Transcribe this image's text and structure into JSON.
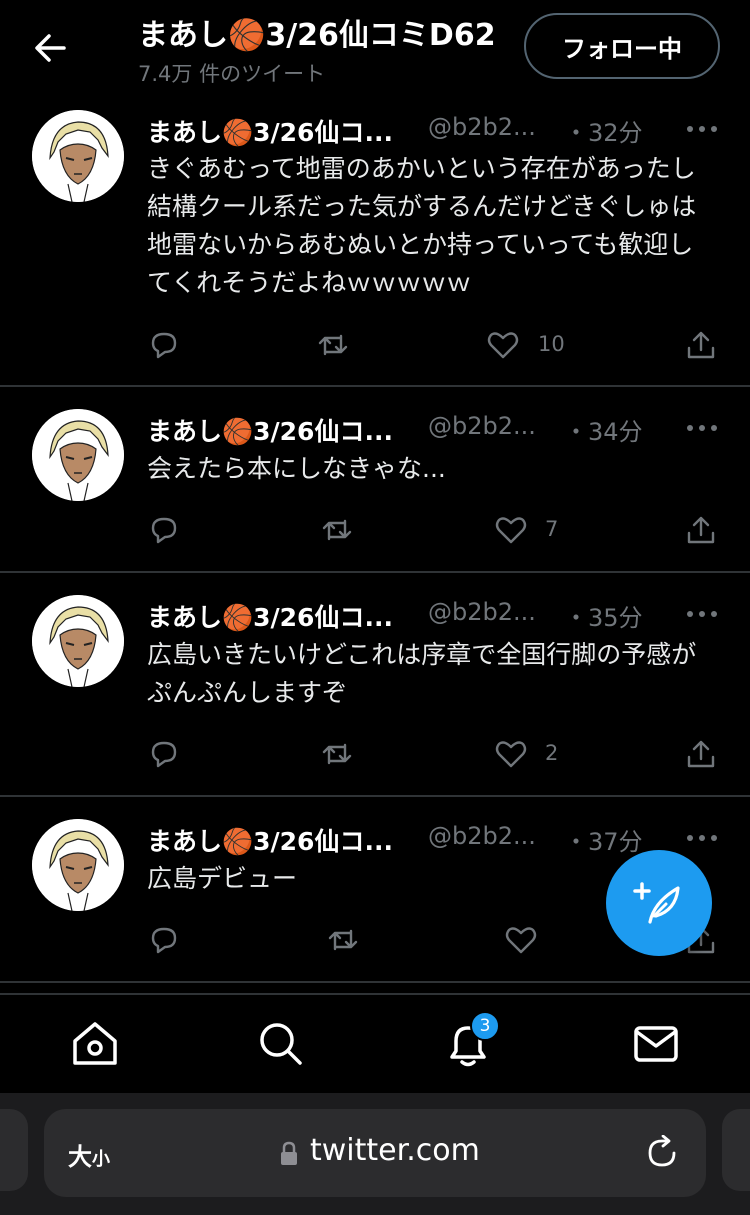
{
  "header": {
    "title": "まあし🏀3/26仙コミD62",
    "tweet_count": "7.4万 件のツイート",
    "follow_label": "フォロー中"
  },
  "tweets": [
    {
      "name": "まあし🏀3/26仙コ...",
      "handle": "@b2b2...",
      "time": "・32分",
      "text": "きぐあむって地雷のあかいという存在があったし結構クール系だった気がするんだけどきぐしゅは地雷ないからあむぬいとか持っていっても歓迎してくれそうだよねｗｗｗｗｗ",
      "likes": "10"
    },
    {
      "name": "まあし🏀3/26仙コ...",
      "handle": "@b2b2...",
      "time": "・34分",
      "text": "会えたら本にしなきゃな...",
      "likes": "7"
    },
    {
      "name": "まあし🏀3/26仙コ...",
      "handle": "@b2b2...",
      "time": "・35分",
      "text": "広島いきたいけどこれは序章で全国行脚の予感がぷんぷんしますぞ",
      "likes": "2"
    },
    {
      "name": "まあし🏀3/26仙コ...",
      "handle": "@b2b2...",
      "time": "・37分",
      "text": "広島デビュー",
      "likes": ""
    }
  ],
  "nav": {
    "notification_badge": "3"
  },
  "browser": {
    "text_size_label": "大",
    "text_size_small": "小",
    "url": "twitter.com"
  },
  "colors": {
    "background": "#000000",
    "accent": "#1d9bf0",
    "secondary_text": "#71767b",
    "divider": "#2f3336"
  },
  "icons": [
    "back-arrow-icon",
    "more-icon",
    "reply-icon",
    "retweet-icon",
    "like-icon",
    "share-icon",
    "compose-icon",
    "home-icon",
    "search-icon",
    "notifications-icon",
    "messages-icon",
    "lock-icon",
    "reload-icon"
  ]
}
